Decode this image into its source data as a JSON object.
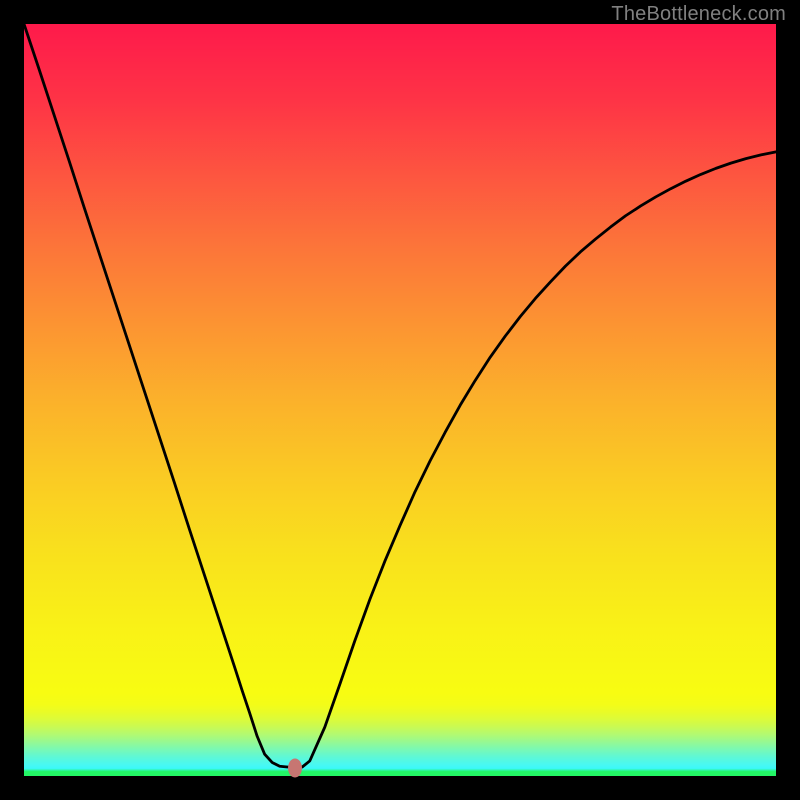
{
  "watermark": "TheBottleneck.com",
  "chart_data": {
    "type": "line",
    "title": "",
    "xlabel": "",
    "ylabel": "",
    "xlim": [
      0,
      100
    ],
    "ylim": [
      0,
      100
    ],
    "x": [
      0,
      2,
      4,
      6,
      8,
      10,
      12,
      14,
      16,
      18,
      20,
      22,
      24,
      26,
      28,
      29,
      30,
      31,
      32,
      33,
      34,
      35,
      36,
      37,
      38,
      40,
      42,
      44,
      46,
      48,
      50,
      52,
      54,
      56,
      58,
      60,
      62,
      64,
      66,
      68,
      70,
      72,
      74,
      76,
      78,
      80,
      82,
      84,
      86,
      88,
      90,
      92,
      94,
      96,
      98,
      100
    ],
    "values": [
      100,
      94,
      87.9,
      81.8,
      75.6,
      69.5,
      63.4,
      57.3,
      51.2,
      45.1,
      39,
      32.8,
      26.7,
      20.6,
      14.5,
      11.4,
      8.4,
      5.3,
      2.9,
      1.8,
      1.3,
      1.2,
      1.2,
      1.2,
      2,
      6.5,
      12.2,
      18,
      23.5,
      28.6,
      33.3,
      37.8,
      41.9,
      45.7,
      49.3,
      52.6,
      55.7,
      58.5,
      61.1,
      63.5,
      65.7,
      67.8,
      69.7,
      71.4,
      73,
      74.5,
      75.8,
      77,
      78.1,
      79.1,
      80,
      80.8,
      81.5,
      82.1,
      82.6,
      83
    ],
    "marker": {
      "x": 36.0,
      "y": 1.1,
      "color": "#c77672"
    },
    "background_gradient": {
      "stops": [
        {
          "pos": 0.0,
          "color": "#fe1a4b"
        },
        {
          "pos": 0.1,
          "color": "#fe3346"
        },
        {
          "pos": 0.2,
          "color": "#fd5540"
        },
        {
          "pos": 0.3,
          "color": "#fc7639"
        },
        {
          "pos": 0.4,
          "color": "#fc9432"
        },
        {
          "pos": 0.5,
          "color": "#fbb12b"
        },
        {
          "pos": 0.6,
          "color": "#faca24"
        },
        {
          "pos": 0.7,
          "color": "#f9e01d"
        },
        {
          "pos": 0.8,
          "color": "#f9f117"
        },
        {
          "pos": 0.87,
          "color": "#f8fa13"
        },
        {
          "pos": 0.89,
          "color": "#f8fc12"
        },
        {
          "pos": 0.905,
          "color": "#f3fc18"
        },
        {
          "pos": 0.915,
          "color": "#e9fb27"
        },
        {
          "pos": 0.925,
          "color": "#dbfb3b"
        },
        {
          "pos": 0.935,
          "color": "#c8fa54"
        },
        {
          "pos": 0.945,
          "color": "#b1fa72"
        },
        {
          "pos": 0.955,
          "color": "#95f993"
        },
        {
          "pos": 0.965,
          "color": "#78f9b6"
        },
        {
          "pos": 0.975,
          "color": "#5df8d7"
        },
        {
          "pos": 0.985,
          "color": "#48f8f2"
        },
        {
          "pos": 0.99,
          "color": "#3cf8fa"
        },
        {
          "pos": 0.994,
          "color": "#23f666"
        },
        {
          "pos": 1.0,
          "color": "#23f666"
        }
      ]
    }
  }
}
